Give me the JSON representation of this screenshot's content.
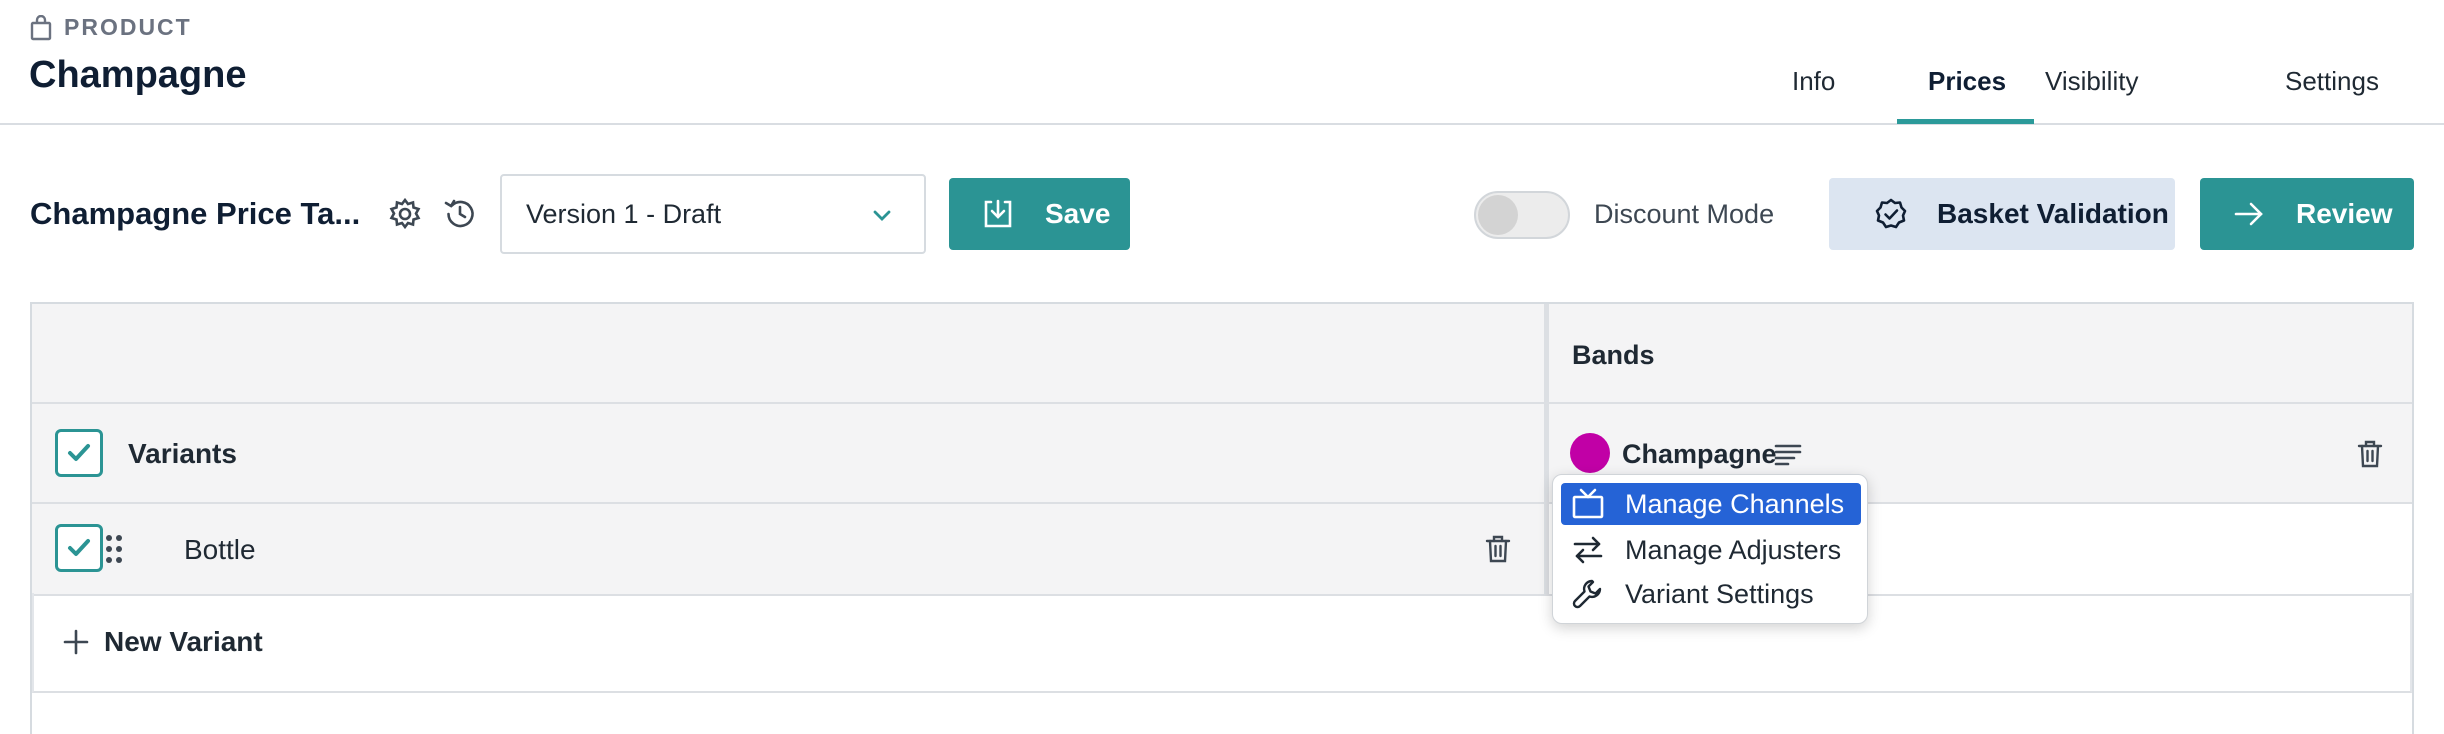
{
  "header": {
    "eyebrow": "PRODUCT",
    "title": "Champagne",
    "tabs": [
      {
        "label": "Info",
        "active": false
      },
      {
        "label": "Prices",
        "active": true
      },
      {
        "label": "Visibility",
        "active": false
      },
      {
        "label": "Settings",
        "active": false
      }
    ]
  },
  "toolbar": {
    "title": "Champagne Price Ta...",
    "version": {
      "selected": "Version 1 - Draft"
    },
    "save_label": "Save",
    "discount_mode": {
      "label": "Discount Mode",
      "on": false
    },
    "basket_validation_label": "Basket Validation",
    "review_label": "Review"
  },
  "table": {
    "bands_header": "Bands",
    "variants_label": "Variants",
    "rows": [
      {
        "label": "Bottle",
        "checked": true
      }
    ],
    "band": {
      "name": "Champagne",
      "color": "#c100a6"
    },
    "new_variant_label": "New Variant"
  },
  "menu": {
    "items": [
      {
        "label": "Manage Channels",
        "icon": "tv-icon",
        "selected": true
      },
      {
        "label": "Manage Adjusters",
        "icon": "swap-arrows-icon",
        "selected": false
      },
      {
        "label": "Variant Settings",
        "icon": "wrench-icon",
        "selected": false
      }
    ]
  },
  "colors": {
    "accent": "#2b9494",
    "menu_selected": "#2563d6",
    "band": "#c100a6",
    "light_button": "#dce5f1"
  }
}
